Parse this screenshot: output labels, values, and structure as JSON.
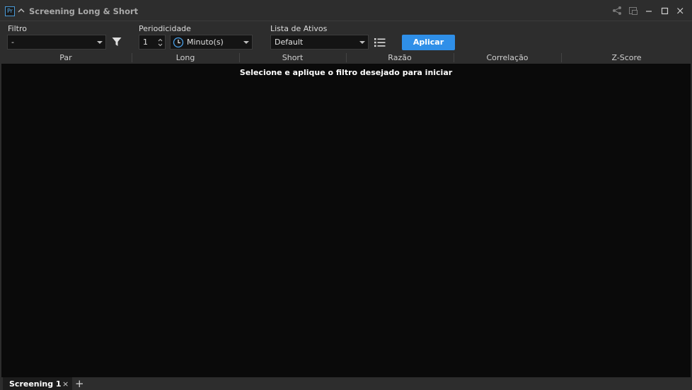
{
  "window": {
    "badge": "Pr",
    "title": "Screening Long & Short"
  },
  "toolbar": {
    "filter_label": "Filtro",
    "filter_value": "-",
    "period_label": "Periodicidade",
    "period_value": "1",
    "period_unit": "Minuto(s)",
    "asset_list_label": "Lista de Ativos",
    "asset_list_value": "Default",
    "apply_label": "Aplicar"
  },
  "columns": [
    "Par",
    "Long",
    "Short",
    "Razão",
    "Correlação",
    "Z-Score"
  ],
  "content": {
    "empty_message": "Selecione e aplique o filtro desejado para iniciar"
  },
  "tabs": {
    "items": [
      {
        "label": "Screening 1",
        "close": "×"
      }
    ],
    "add": "+"
  },
  "icons": {
    "filter": "funnel-icon",
    "clock": "clock-icon",
    "list": "list-icon",
    "share": "share-icon",
    "popout": "popout-icon",
    "minimize": "minimize-icon",
    "maximize": "maximize-icon",
    "close": "close-icon"
  },
  "colors": {
    "accent": "#2f8fe8",
    "background": "#0a0a0a",
    "panel": "#2d2d2d"
  }
}
